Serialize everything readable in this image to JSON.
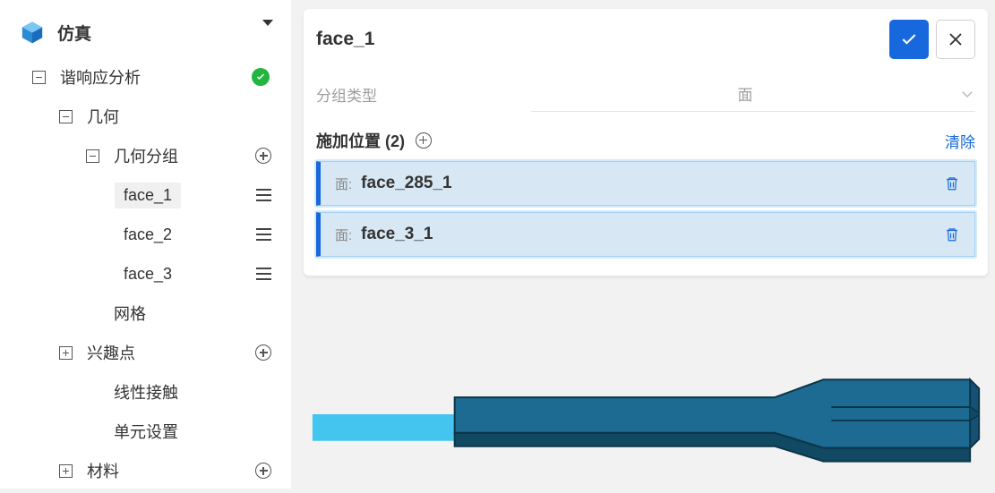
{
  "sidebar": {
    "title": "仿真",
    "analysis": "谐响应分析",
    "geometry": "几何",
    "geometry_group": "几何分组",
    "faces": [
      "face_1",
      "face_2",
      "face_3"
    ],
    "mesh": "网格",
    "interest": "兴趣点",
    "contact": "线性接触",
    "element": "单元设置",
    "material": "材料"
  },
  "panel": {
    "title": "face_1",
    "group_type_label": "分组类型",
    "group_type_value": "面",
    "section_title": "施加位置 (2)",
    "clear": "清除",
    "face_prefix": "面:",
    "items": [
      {
        "name": "face_285_1"
      },
      {
        "name": "face_3_1"
      }
    ]
  }
}
